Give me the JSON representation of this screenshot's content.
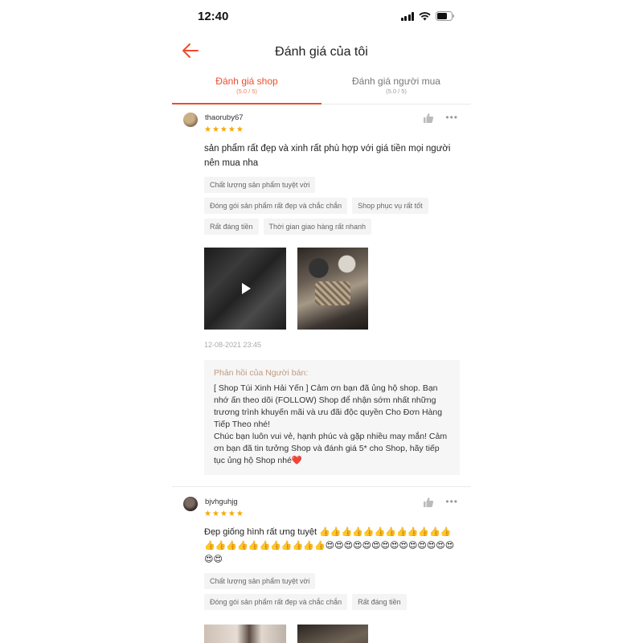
{
  "status_bar": {
    "time": "12:40"
  },
  "header": {
    "title": "Đánh giá của tôi"
  },
  "tabs": [
    {
      "label": "Đánh giá shop",
      "sub": "(5.0 / 5)"
    },
    {
      "label": "Đánh giá người mua",
      "sub": "(5.0 / 5)"
    }
  ],
  "reviews": [
    {
      "username": "thaoruby67",
      "stars": "★★★★★",
      "text": "sản phẩm rất đẹp và xinh rất phù hợp với giá tiền mọi người nên mua nha",
      "tags": [
        "Chất lượng sản phẩm tuyệt vời",
        "Đóng gói sản phẩm rất đẹp và chắc chắn",
        "Shop phục vụ rất tốt",
        "Rất đáng tiền",
        "Thời gian giao hàng rất nhanh"
      ],
      "date": "12-08-2021 23:45",
      "seller_reply_label": "Phản hồi của Người bán:",
      "seller_reply": "[ Shop Túi Xinh Hải Yến ] Cảm ơn bạn đã ủng hộ shop. Bạn nhớ ấn theo dõi (FOLLOW) Shop để nhận sớm nhất những trương trình khuyến mãi và ưu đãi độc quyền Cho Đơn Hàng Tiếp Theo nhé!\nChúc bạn luôn vui vẻ, hạnh phúc và gặp nhiều may mắn! Cảm ơn bạn đã tin tưởng Shop và đánh giá 5* cho Shop, hãy tiếp tục ủng hộ Shop nhé❤️"
    },
    {
      "username": "bjvhguhjg",
      "stars": "★★★★★",
      "text": "Đẹp giống hình rất ưng tuyệt 👍👍👍👍👍👍👍👍👍👍👍👍👍👍👍👍👍👍👍👍👍👍👍😍😍😍😍😍😍😍😍😍😍😍😍😍😍😍😍",
      "tags": [
        "Chất lượng sản phẩm tuyệt vời",
        "Đóng gói sản phẩm rất đẹp và chắc chắn",
        "Rất đáng tiền"
      ]
    }
  ],
  "colors": {
    "accent": "#ee4d2d",
    "star": "#f6a700"
  }
}
